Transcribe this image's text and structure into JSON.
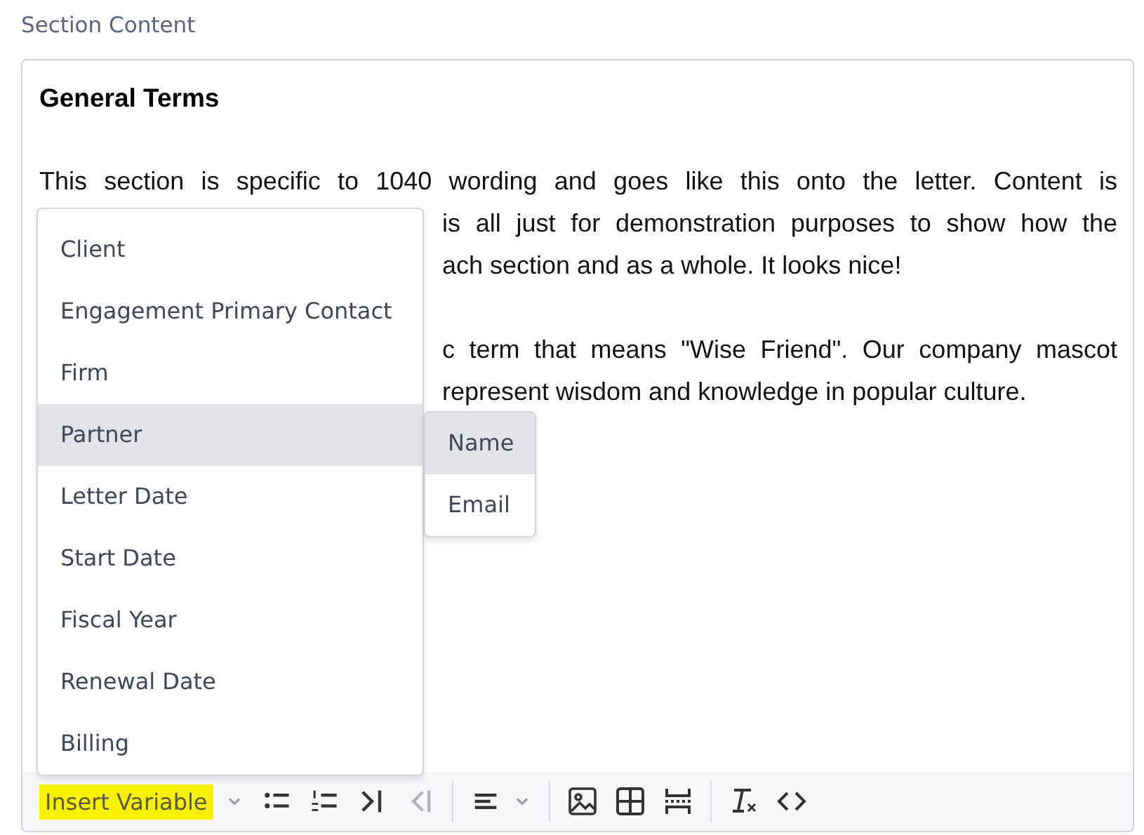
{
  "label": "Section Content",
  "editor": {
    "heading": "General Terms",
    "lines": [
      {
        "text": "This section is specific to 1040 wording and goes like this onto the letter. Content is",
        "covered": false,
        "gap_before": false,
        "last": false
      },
      {
        "text": "is all just for demonstration purposes to show how the",
        "covered": true,
        "gap_before": false,
        "last": false
      },
      {
        "text": "ach section and as a whole. It looks nice!",
        "covered": true,
        "gap_before": false,
        "last": true
      },
      {
        "text": "c term that means \"Wise Friend\". Our company mascot",
        "covered": true,
        "gap_before": true,
        "last": false
      },
      {
        "text": "represent wisdom and knowledge in popular culture.",
        "covered": true,
        "gap_before": false,
        "last": true
      }
    ]
  },
  "menu": {
    "items": [
      {
        "label": "Client",
        "selected": false
      },
      {
        "label": "Engagement Primary Contact",
        "selected": false
      },
      {
        "label": "Firm",
        "selected": false
      },
      {
        "label": "Partner",
        "selected": true,
        "children": [
          {
            "label": "Name",
            "selected": true
          },
          {
            "label": "Email",
            "selected": false
          }
        ]
      },
      {
        "label": "Letter Date",
        "selected": false
      },
      {
        "label": "Start Date",
        "selected": false
      },
      {
        "label": "Fiscal Year",
        "selected": false
      },
      {
        "label": "Renewal Date",
        "selected": false
      },
      {
        "label": "Billing",
        "selected": false
      }
    ]
  },
  "toolbar": {
    "insert_variable": {
      "label": "Insert Variable",
      "highlighted": true
    },
    "outdent_disabled": true
  }
}
